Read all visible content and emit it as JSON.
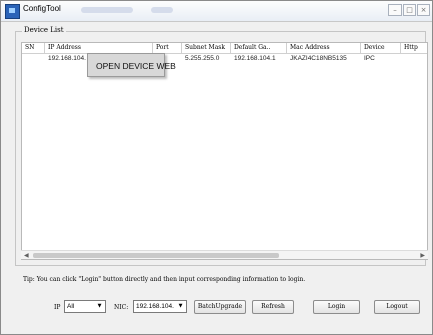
{
  "window": {
    "title": "ConfigTool",
    "buttons": [
      "–",
      "□",
      "×"
    ]
  },
  "device_list": {
    "label": "Device List",
    "columns": [
      "SN",
      "IP Address",
      "Port",
      "Subnet Mask",
      "Default Ga..",
      "Mac Address",
      "Device",
      "Http"
    ],
    "rows": [
      {
        "sn": "",
        "ip": "192.168.104.",
        "port": "",
        "mask": "5.255.255.0",
        "gateway": "192.168.104.1",
        "mac": "JKAZI4C18NB5135",
        "device": "IPC",
        "http": ""
      }
    ]
  },
  "context_menu": {
    "item": "OPEN DEVICE WEB"
  },
  "tip": "Tip: You can click \"Login\" button directly and then input corresponding information to login.",
  "controls": {
    "ip_label": "IP",
    "ip_value": "All",
    "nic_label": "NIC:",
    "nic_value": "192.168.104.",
    "batch_upgrade": "BatchUpgrade",
    "refresh": "Refresh",
    "login": "Login",
    "logout": "Logout"
  }
}
